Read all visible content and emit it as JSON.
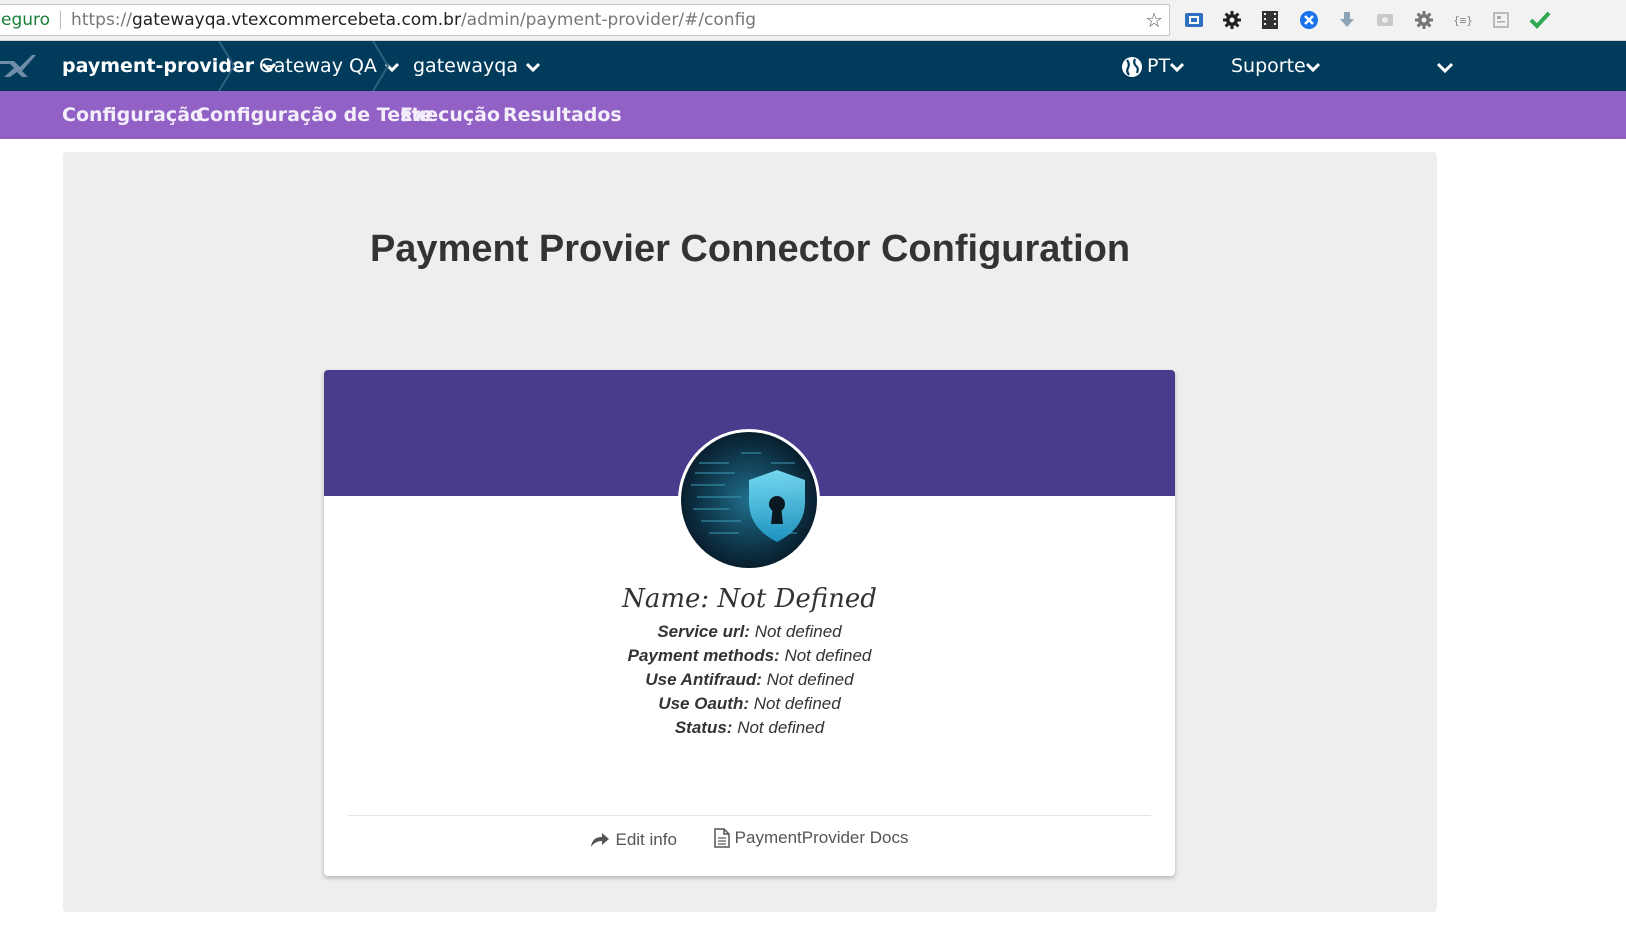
{
  "browser": {
    "secure_label": "eguro",
    "url_scheme": "https://",
    "url_host": "gatewayqa.vtexcommercebeta.com.br",
    "url_path": "/admin/payment-provider/#/config"
  },
  "topnav": {
    "account": "payment-provider",
    "store": "Gateway QA",
    "environment": "gatewayqa",
    "language": "PT",
    "support": "Suporte"
  },
  "subnav": {
    "items": [
      "Configuração",
      "Configuração de Teste",
      "Execução",
      "Resultados"
    ]
  },
  "page": {
    "title": "Payment Provier Connector Configuration"
  },
  "card": {
    "name_label": "Name:",
    "name_value": "Not Defined",
    "fields": [
      {
        "label": "Service url:",
        "value": "Not defined"
      },
      {
        "label": "Payment methods:",
        "value": "Not defined"
      },
      {
        "label": "Use Antifraud:",
        "value": "Not defined"
      },
      {
        "label": "Use Oauth:",
        "value": "Not defined"
      },
      {
        "label": "Status:",
        "value": "Not defined"
      }
    ],
    "edit_label": "Edit info",
    "docs_label": "PaymentProvider Docs"
  },
  "colors": {
    "topnav": "#003b5c",
    "subnav": "#9161c6",
    "card_header": "#493c8d",
    "panel": "#eeeeee"
  }
}
